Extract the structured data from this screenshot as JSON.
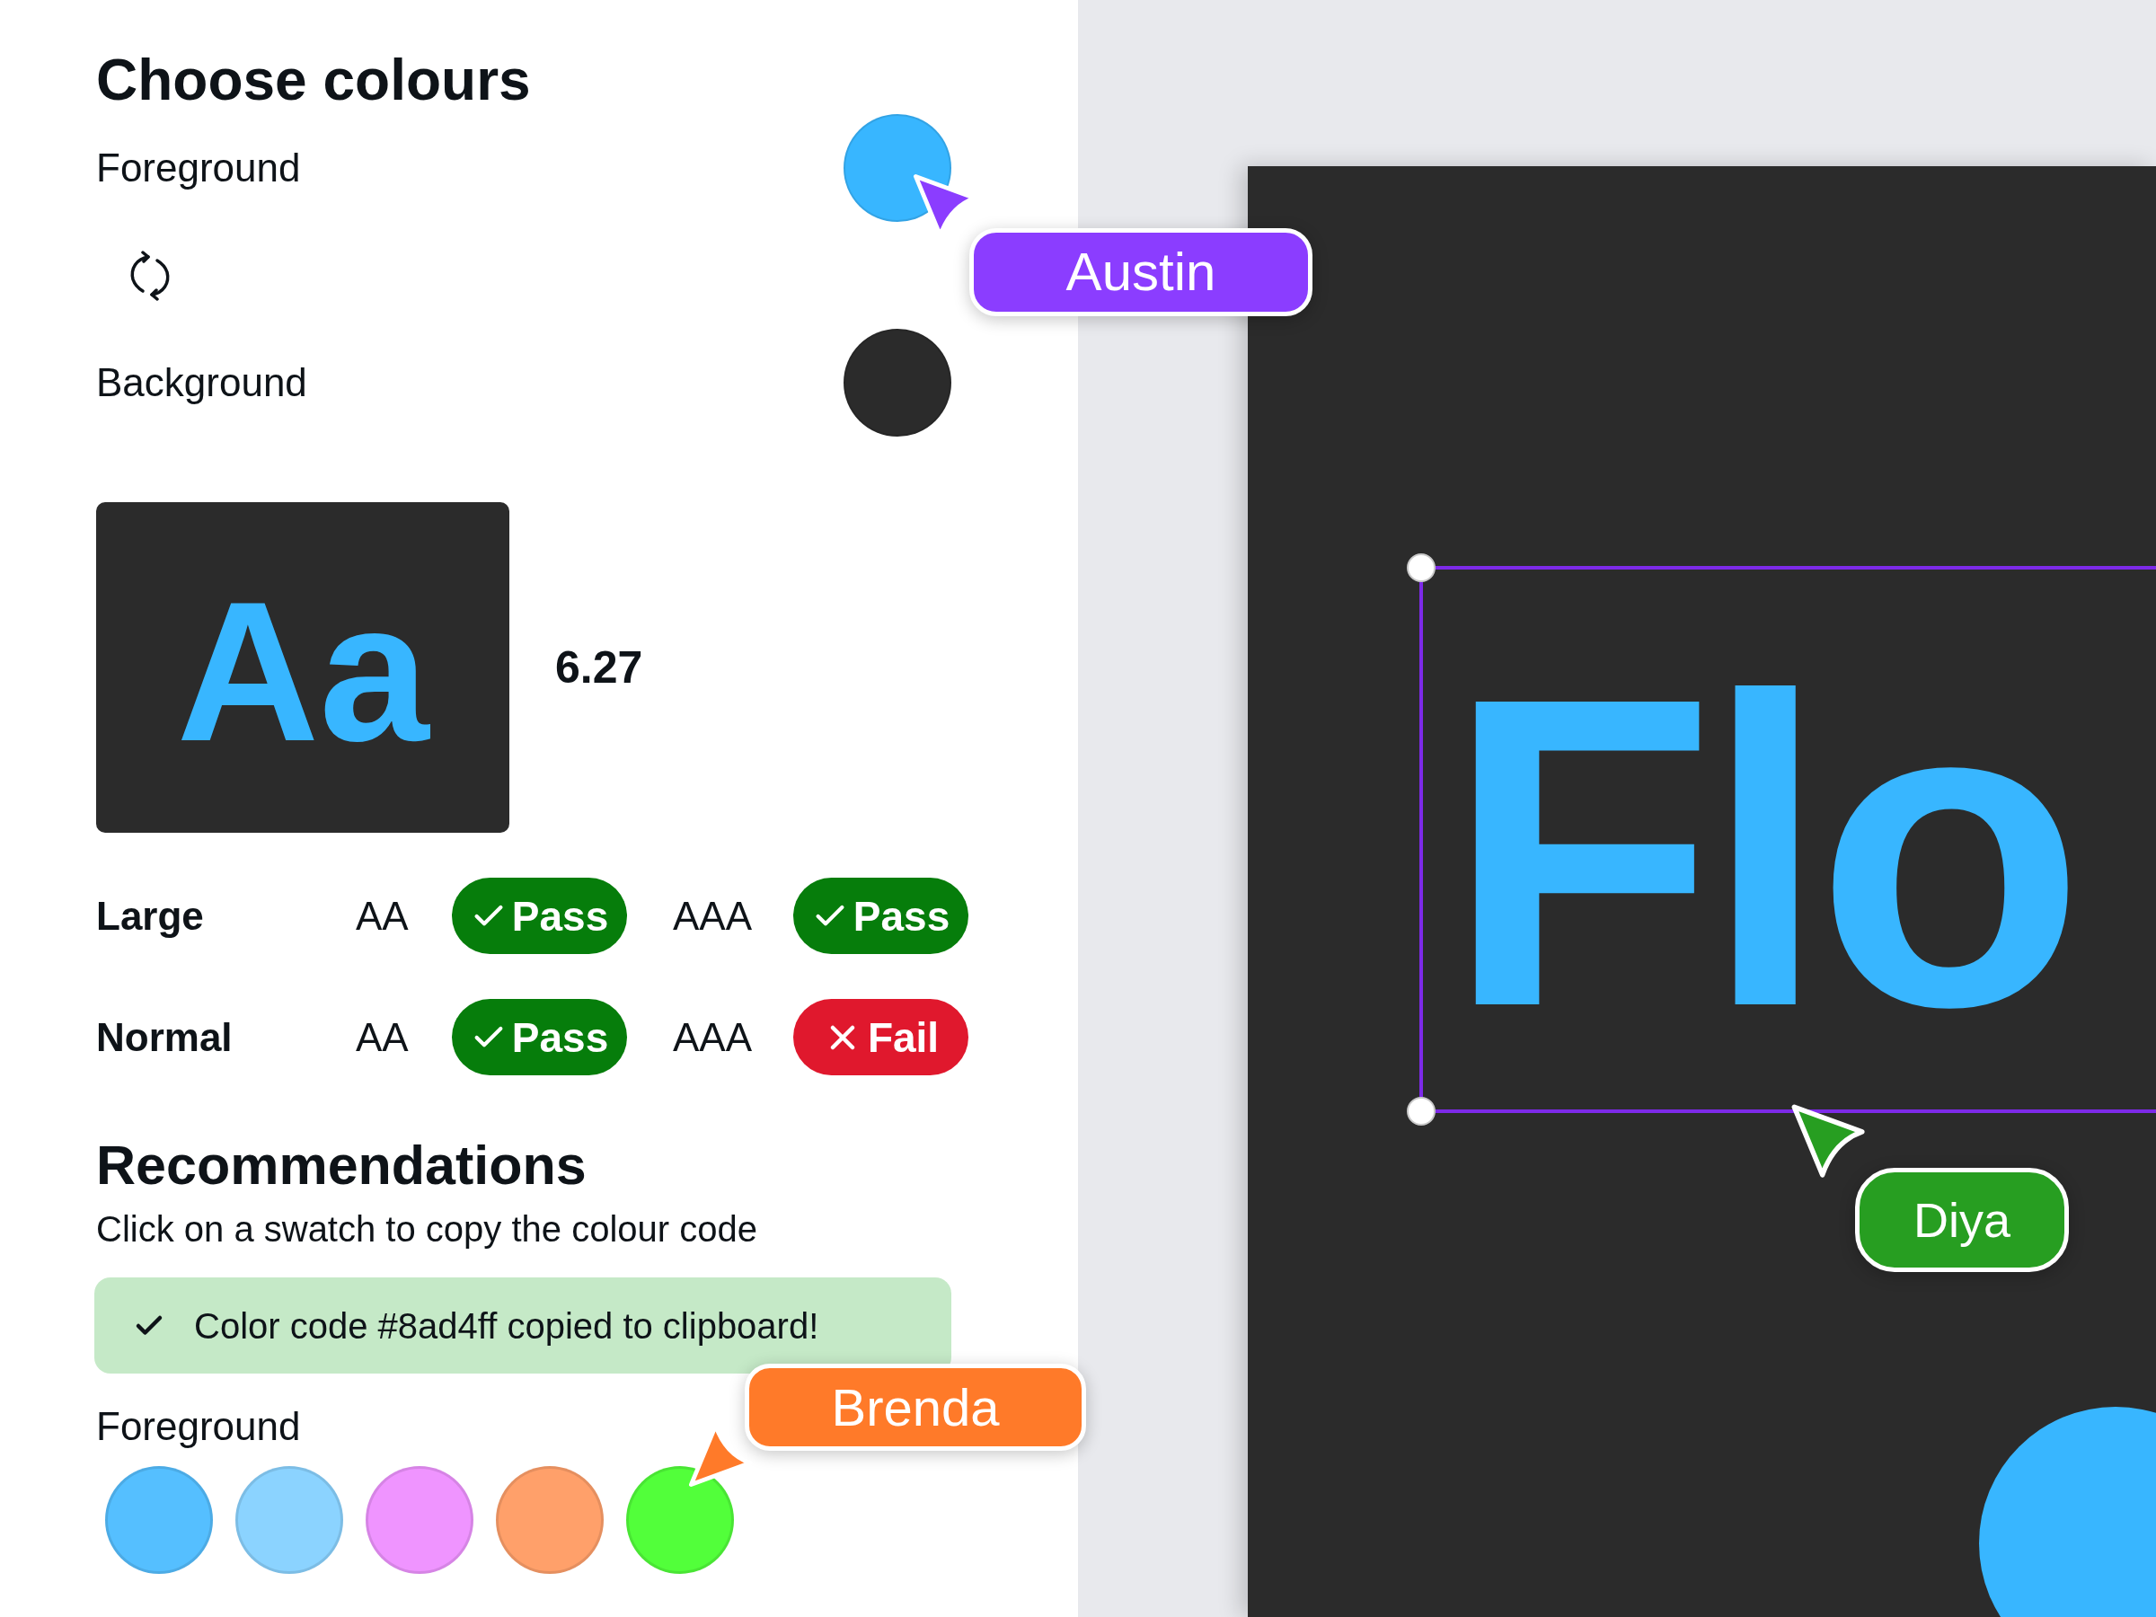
{
  "panel": {
    "title": "Choose colours",
    "foreground": {
      "label": "Foreground",
      "color": "#38b6ff"
    },
    "background": {
      "label": "Background",
      "color": "#2b2b2b"
    },
    "preview": {
      "sample": "Aa",
      "ratio": "6.27"
    },
    "checks": [
      {
        "label": "Large",
        "results": [
          {
            "level": "AA",
            "result": "Pass",
            "passed": true
          },
          {
            "level": "AAA",
            "result": "Pass",
            "passed": true
          }
        ]
      },
      {
        "label": "Normal",
        "results": [
          {
            "level": "AA",
            "result": "Pass",
            "passed": true
          },
          {
            "level": "AAA",
            "result": "Fail",
            "passed": false
          }
        ]
      }
    ]
  },
  "recommendations": {
    "title": "Recommendations",
    "hint": "Click on a swatch to copy the colour code",
    "toast": {
      "message": "Color code #8ad4ff copied to clipboard!"
    },
    "foreground": {
      "label": "Foreground",
      "swatches": [
        {
          "color": "#55bfff"
        },
        {
          "color": "#8bd3ff"
        },
        {
          "color": "#ef94ff"
        },
        {
          "color": "#ffa06a"
        },
        {
          "color": "#52ff3a"
        }
      ]
    }
  },
  "canvas": {
    "text": "Flo",
    "selected": true
  },
  "collaborators": [
    {
      "name": "Austin",
      "color": "#8b3dff"
    },
    {
      "name": "Diya",
      "color": "#279e21"
    },
    {
      "name": "Brenda",
      "color": "#ff7a29"
    }
  ]
}
